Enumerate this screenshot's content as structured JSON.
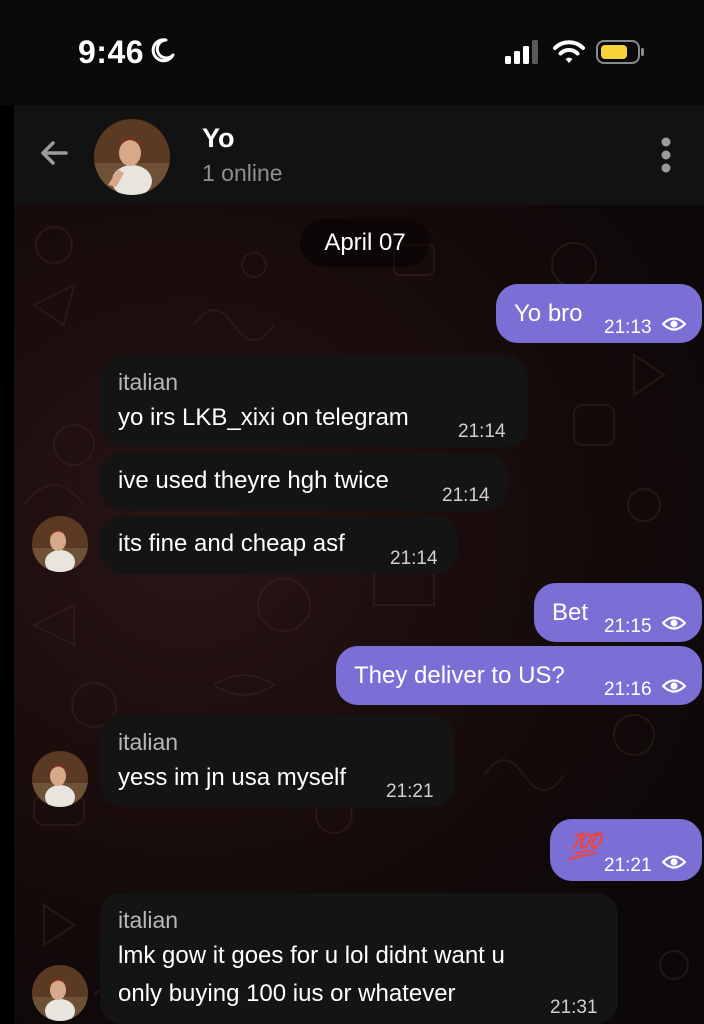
{
  "status_bar": {
    "time": "9:46"
  },
  "header": {
    "title": "Yo",
    "subtitle": "1 online"
  },
  "date_separator": "April 07",
  "messages": [
    {
      "direction": "outgoing",
      "text": "Yo bro",
      "time": "21:13"
    },
    {
      "direction": "incoming",
      "sender": "italian",
      "text": "yo irs LKB_xixi on telegram",
      "time": "21:14"
    },
    {
      "direction": "incoming",
      "text": "ive used theyre hgh twice",
      "time": "21:14"
    },
    {
      "direction": "incoming",
      "text": "its fine and cheap asf",
      "time": "21:14"
    },
    {
      "direction": "outgoing",
      "text": "Bet",
      "time": "21:15"
    },
    {
      "direction": "outgoing",
      "text": "They deliver to US?",
      "time": "21:16"
    },
    {
      "direction": "incoming",
      "sender": "italian",
      "text": "yess im jn usa myself",
      "time": "21:21"
    },
    {
      "direction": "outgoing",
      "text": "💯",
      "time": "21:21"
    },
    {
      "direction": "incoming",
      "sender": "italian",
      "text_line1": "lmk gow it goes for u lol didnt want u",
      "text_line2": "only buying 100 ius or whatever",
      "time": "21:31"
    }
  ],
  "colors": {
    "outgoing_bubble": "#7b6fd6",
    "incoming_bubble": "#141414",
    "header_bg": "#121212",
    "battery": "#f5d33b"
  },
  "icons": [
    "moon-icon",
    "signal-icon",
    "wifi-icon",
    "battery-icon",
    "back-arrow-icon",
    "more-vertical-icon",
    "seen-eye-icon"
  ]
}
